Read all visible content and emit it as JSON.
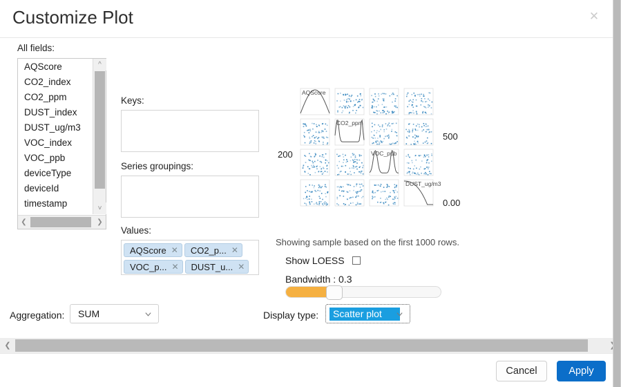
{
  "dialog": {
    "title": "Customize Plot",
    "close_icon": "close-icon"
  },
  "panels": {
    "all_fields_label": "All fields:",
    "keys_label": "Keys:",
    "series_groupings_label": "Series groupings:",
    "values_label": "Values:"
  },
  "all_fields": [
    "AQScore",
    "CO2_index",
    "CO2_ppm",
    "DUST_index",
    "DUST_ug/m3",
    "VOC_index",
    "VOC_ppb",
    "deviceType",
    "deviceId",
    "timestamp"
  ],
  "keys": [],
  "series_groupings": [],
  "values": [
    {
      "label": "AQScore",
      "remove_icon": "close-icon"
    },
    {
      "label": "CO2_p...",
      "remove_icon": "close-icon"
    },
    {
      "label": "VOC_p...",
      "remove_icon": "close-icon"
    },
    {
      "label": "DUST_u...",
      "remove_icon": "close-icon"
    }
  ],
  "chart_note": "Showing sample based on the first 1000 rows.",
  "loess": {
    "label": "Show LOESS",
    "checked": false,
    "bandwidth_label": "Bandwidth : 0.3",
    "bandwidth_value": 0.3
  },
  "aggregation": {
    "label": "Aggregation:",
    "value": "SUM",
    "caret_icon": "chevron-down-icon"
  },
  "display_type": {
    "label": "Display type:",
    "value": "Scatter plot",
    "caret_icon": "chevron-down-icon"
  },
  "footer": {
    "cancel_label": "Cancel",
    "apply_label": "Apply"
  },
  "scrollbars": {
    "left_arrow_icon": "chevron-left-icon",
    "right_arrow_icon": "chevron-right-icon",
    "up_arrow_icon": "chevron-up-icon",
    "down_arrow_icon": "chevron-down-icon"
  },
  "chart_data": {
    "type": "scatter",
    "title": "",
    "variant": "scatter-plot-matrix",
    "variables": [
      "AQScore",
      "CO2_ppm",
      "VOC_ppb",
      "DUST_ug/m3"
    ],
    "diagonal": "density-curve",
    "axis_tick_labels": [
      {
        "text": "200",
        "position": "left"
      },
      {
        "text": "500",
        "position": "right-upper"
      },
      {
        "text": "0.00",
        "position": "right-lower"
      }
    ],
    "point_color": "#2a7fba",
    "density_color": "#555555",
    "grid": false,
    "legend": "none"
  }
}
